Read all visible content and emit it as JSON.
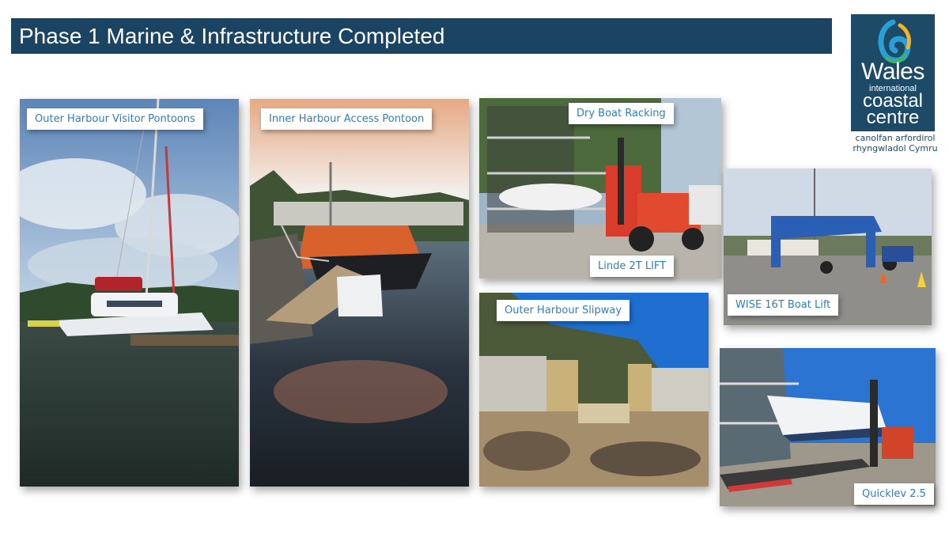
{
  "slide": {
    "title": "Phase 1 Marine & Infrastructure Completed"
  },
  "logo": {
    "line1": "Wales",
    "line2": "international",
    "line3": "coastal",
    "line4": "centre",
    "welsh_line1": "canolfan arfordirol",
    "welsh_line2": "rhyngwladol Cymru"
  },
  "photos": [
    {
      "caption": "Outer Harbour Visitor Pontoons"
    },
    {
      "caption": "Inner Harbour Access Pontoon"
    },
    {
      "caption": "Dry Boat Racking"
    },
    {
      "caption": "Linde 2T LIFT"
    },
    {
      "caption": "WISE 16T Boat Lift"
    },
    {
      "caption": "Outer Harbour Slipway"
    },
    {
      "caption": "Quicklev 2.5"
    }
  ],
  "colors": {
    "title_bar": "#1b4462",
    "logo_bg": "#1d4a66",
    "caption_text": "#2f7fb5"
  }
}
